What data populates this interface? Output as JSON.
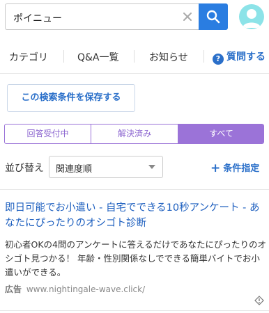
{
  "search": {
    "query": "ポイニュー"
  },
  "nav": {
    "items": [
      "カテゴリ",
      "Q&A一覧",
      "お知らせ"
    ],
    "help_label": "質問する"
  },
  "save_condition_label": "この検索条件を保存する",
  "status_tabs": [
    {
      "label": "回答受付中",
      "active": false
    },
    {
      "label": "解決済み",
      "active": false
    },
    {
      "label": "すべて",
      "active": true
    }
  ],
  "sort": {
    "label": "並び替え",
    "selected": "関連度順"
  },
  "condition_link": "条件指定",
  "ad": {
    "title": "即日可能でお小遣い - 自宅でできる10秒アンケート - あなたにぴったりのオシゴト診断",
    "body": "初心者OKの4問のアンケートに答えるだけであなたにぴったりのオシゴト見つかる！ 年齢・性別関係なしでできる簡単バイトでお小遣いができる。",
    "badge": "広告",
    "url": "www.nightingale-wave.click/"
  },
  "colors": {
    "accent_blue": "#2a7de1",
    "tab_purple": "#9b73d8",
    "link_blue": "#1d5fbf",
    "avatar": "#8ce3e8"
  }
}
